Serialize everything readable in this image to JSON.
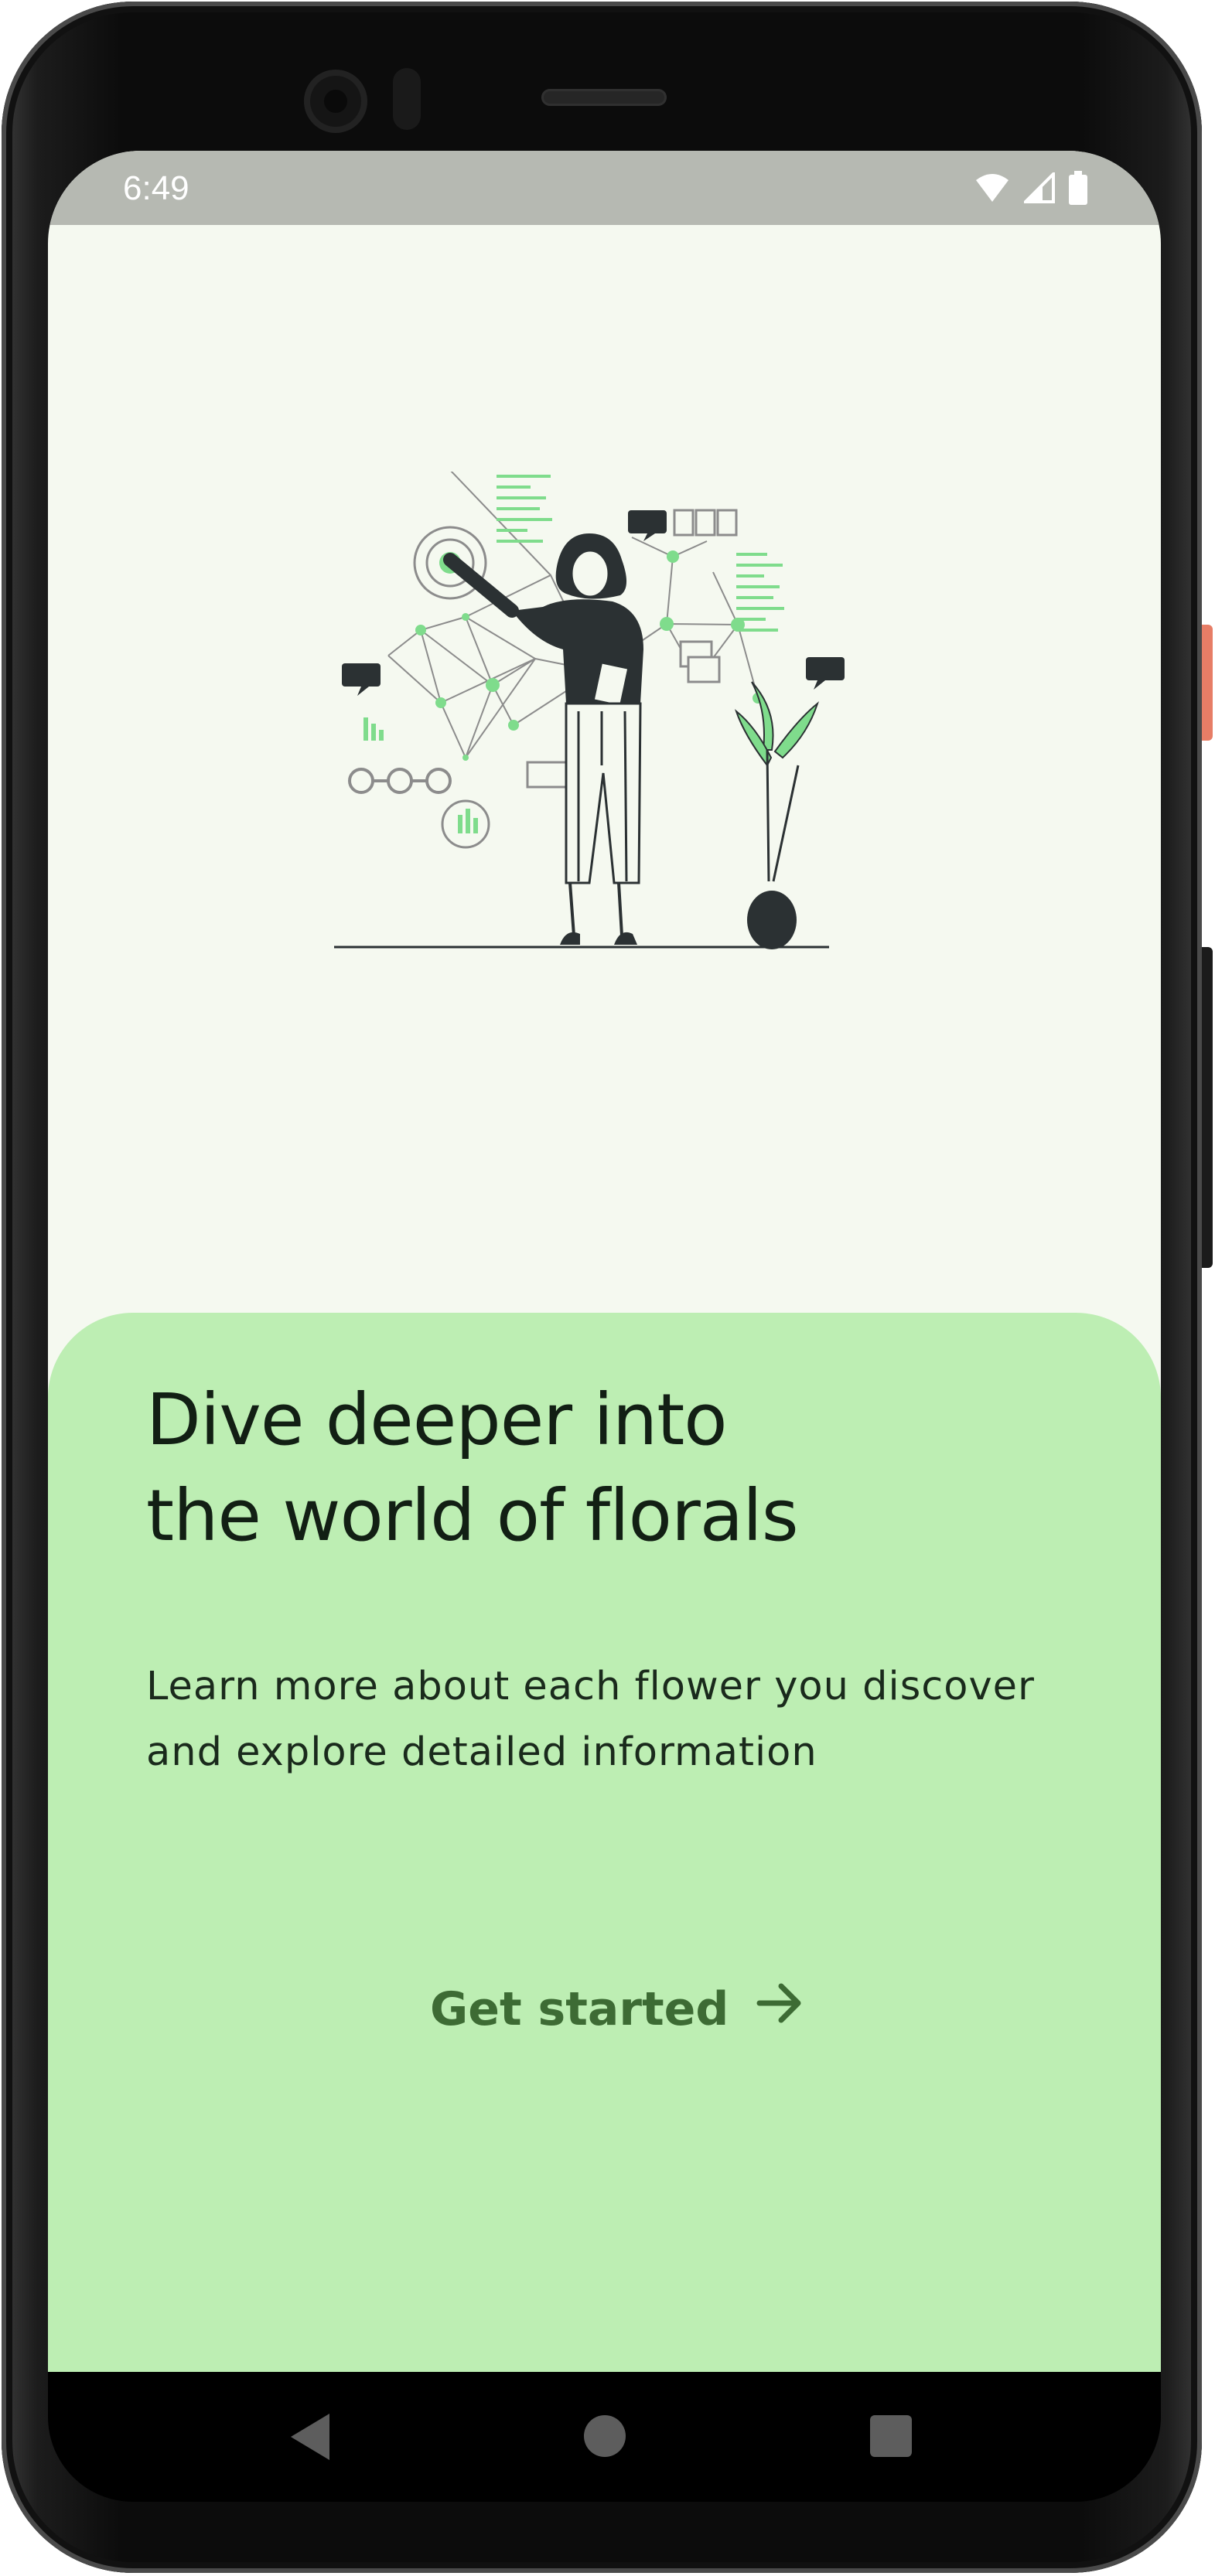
{
  "status_bar": {
    "time": "6:49",
    "icons": [
      "wifi-icon",
      "cell-signal-icon",
      "battery-icon"
    ]
  },
  "illustration": {
    "subject": "woman-presenting-data-network-icon",
    "accent_color": "#7fdc8c"
  },
  "card": {
    "title_line1": "Dive deeper into",
    "title_line2": "the world of florals",
    "subtitle_line1": "Learn more about each flower you discover",
    "subtitle_line2": "and explore detailed information",
    "cta_label": "Get started",
    "cta_icon": "arrow-right-icon"
  },
  "nav_bar": {
    "buttons": [
      "back-icon",
      "home-icon",
      "recents-icon"
    ]
  },
  "colors": {
    "screen_background": "#f5f9f0",
    "card_background": "#bdeeb3",
    "title_text": "#121f14",
    "cta_text": "#3d6b34",
    "status_bar": "#b6b9b2"
  }
}
